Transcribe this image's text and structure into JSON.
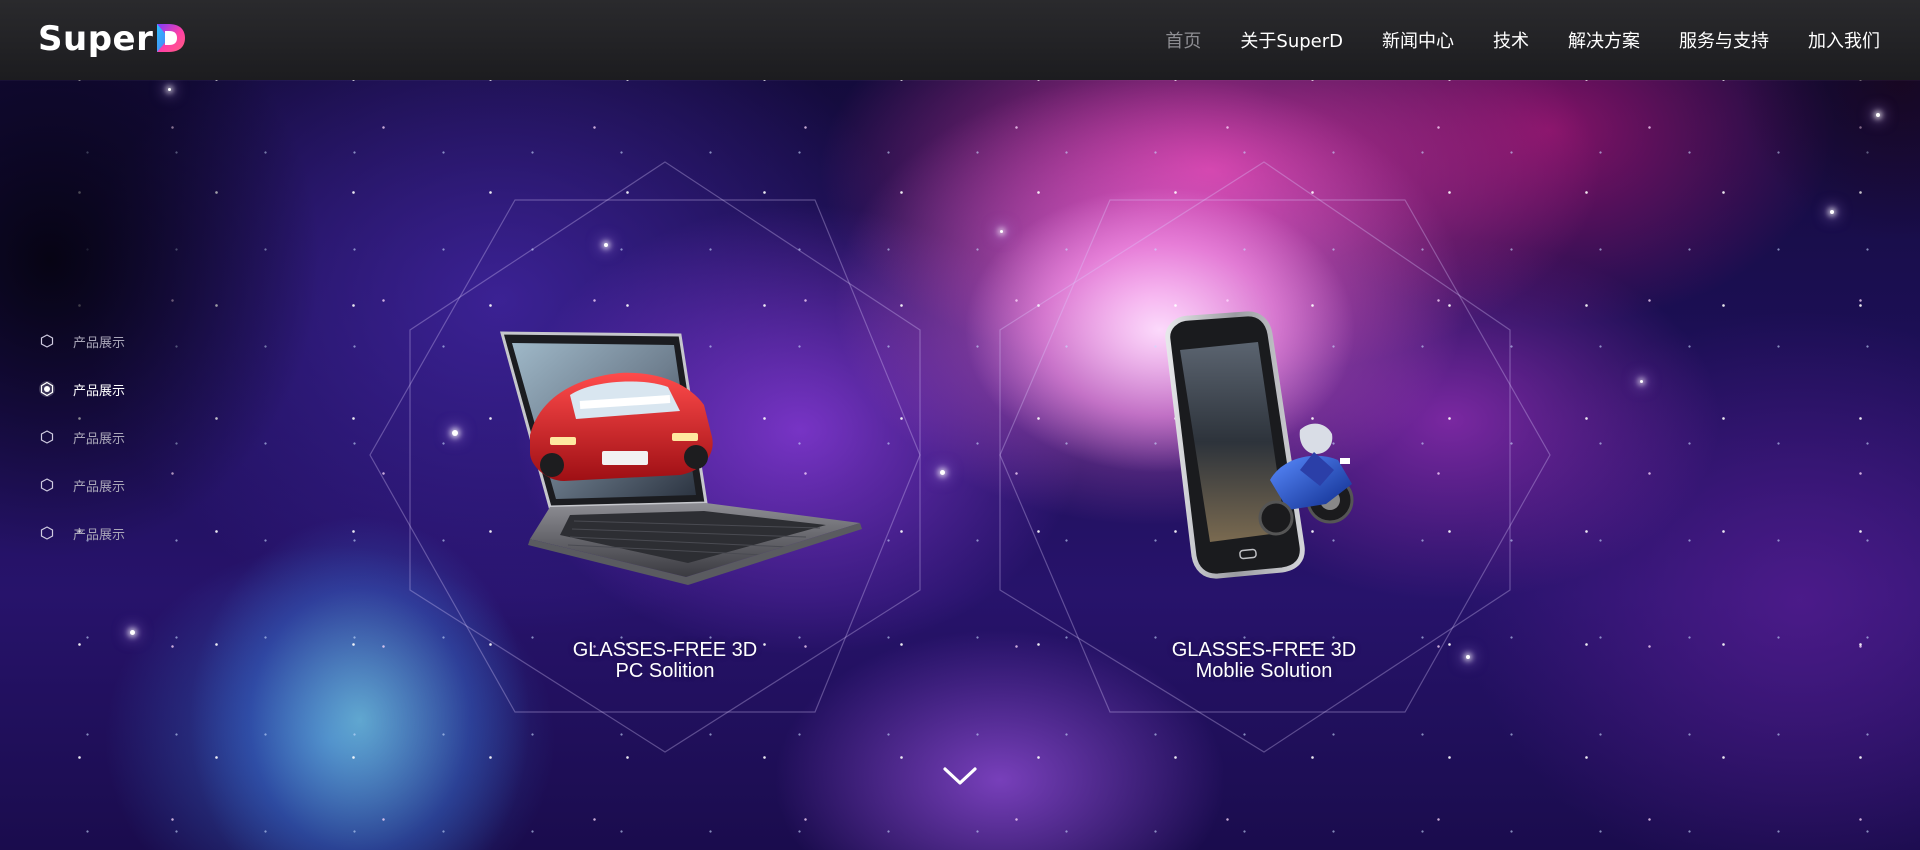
{
  "brand": {
    "logo_text": "Super",
    "logo_mark_letter": "D",
    "logo_colors": [
      "#7a3cff",
      "#ff3fa6",
      "#1fd0ff"
    ]
  },
  "nav": {
    "items": [
      {
        "label": "首页",
        "active": true
      },
      {
        "label": "关于SuperD"
      },
      {
        "label": "新闻中心"
      },
      {
        "label": "技术"
      },
      {
        "label": "解决方案"
      },
      {
        "label": "服务与支持"
      },
      {
        "label": "加入我们"
      }
    ]
  },
  "side_nav": {
    "items": [
      {
        "label": "产品展示"
      },
      {
        "label": "产品展示",
        "active": true
      },
      {
        "label": "产品展示"
      },
      {
        "label": "产品展示"
      },
      {
        "label": "产品展示"
      }
    ]
  },
  "products": [
    {
      "line1": "GLASSES-FREE 3D",
      "line2": "PC Solition",
      "icon": "laptop-3d-icon"
    },
    {
      "line1": "GLASSES-FREE 3D",
      "line2": "Moblie Solution",
      "icon": "phone-3d-icon"
    }
  ],
  "scroll_icon": "chevron-down-icon",
  "colors": {
    "header_bg": "#202023",
    "nav_active": "#8d8d92",
    "text": "#ffffff"
  }
}
